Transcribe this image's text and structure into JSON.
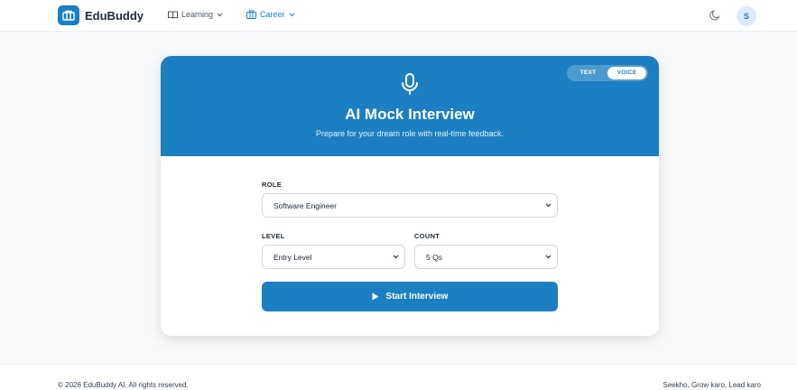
{
  "header": {
    "brand": "EduBuddy",
    "nav": [
      {
        "label": "Learning",
        "icon": "book-open-icon",
        "active": false
      },
      {
        "label": "Career",
        "icon": "briefcase-icon",
        "active": true
      }
    ],
    "theme_icon": "moon-icon",
    "avatar_initial": "S"
  },
  "card": {
    "mode_toggle": {
      "options": [
        "TEXT",
        "VOICE"
      ],
      "selected": "VOICE"
    },
    "icon": "microphone-icon",
    "title": "AI Mock Interview",
    "subtitle": "Prepare for your dream role with real-time feedback.",
    "form": {
      "role_label": "ROLE",
      "role_value": "Software Engineer",
      "level_label": "LEVEL",
      "level_value": "Entry Level",
      "count_label": "COUNT",
      "count_value": "5 Qs"
    },
    "start_label": "Start Interview"
  },
  "footer": {
    "copyright": "© 2026 EduBuddy AI. All rights reserved.",
    "tagline": "Seekho, Grow karo, Lead karo"
  },
  "colors": {
    "accent": "#1b7fc1",
    "background": "#f8f9fa"
  }
}
